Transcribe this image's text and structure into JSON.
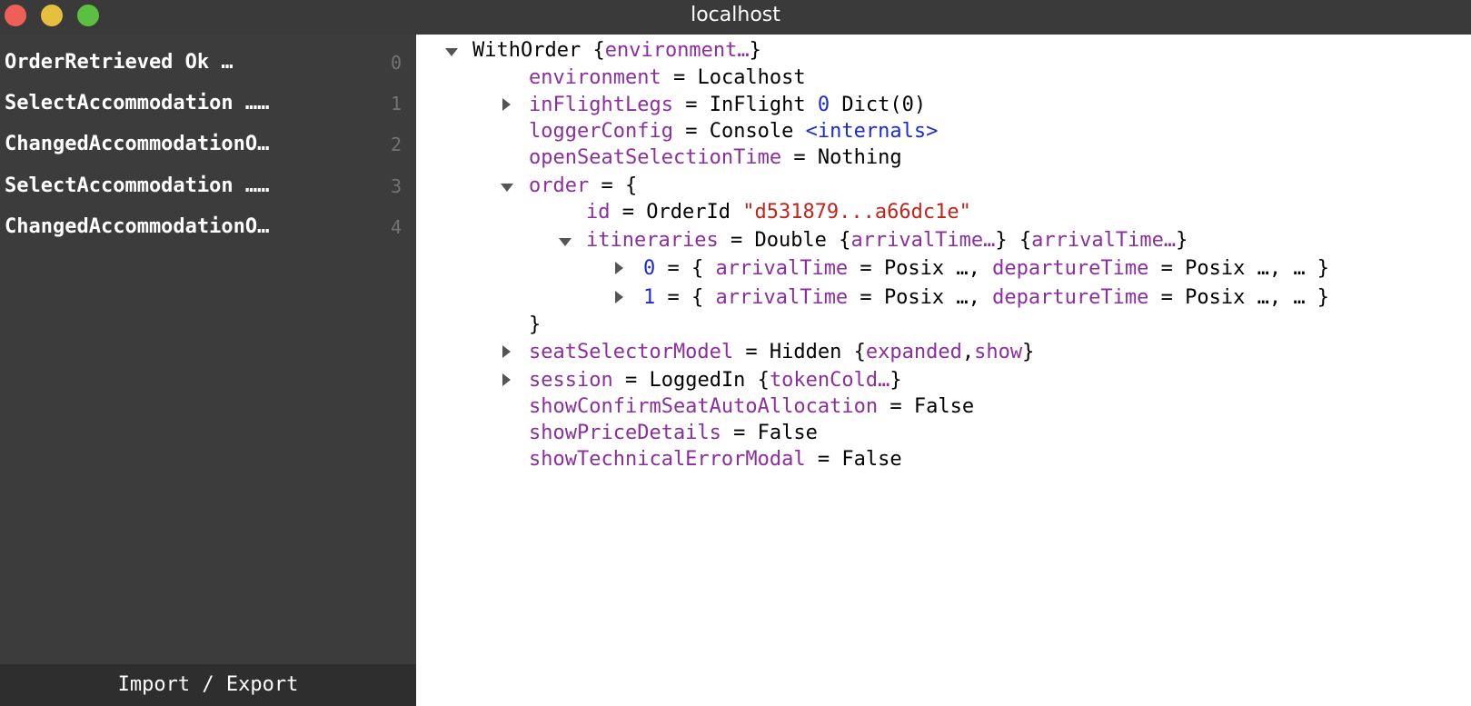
{
  "window": {
    "title": "localhost"
  },
  "sidebar": {
    "messages": [
      {
        "label": "OrderRetrieved Ok …",
        "index": "0"
      },
      {
        "label": "SelectAccommodation ……",
        "index": "1"
      },
      {
        "label": "ChangedAccommodationO…",
        "index": "2"
      },
      {
        "label": "SelectAccommodation ……",
        "index": "3"
      },
      {
        "label": "ChangedAccommodationO…",
        "index": "4"
      }
    ],
    "import_export_label": "Import / Export"
  },
  "tree": {
    "root": {
      "name": "WithOrder",
      "open_brace": "{",
      "preview": "environment…",
      "close_brace": "}"
    },
    "environment": {
      "key": "environment",
      "value": "Localhost"
    },
    "inFlightLegs": {
      "key": "inFlightLegs",
      "value": "InFlight",
      "number": "0",
      "suffix": "Dict(0)"
    },
    "loggerConfig": {
      "key": "loggerConfig",
      "value": "Console",
      "internals": "<internals>"
    },
    "openSeatSelectionTime": {
      "key": "openSeatSelectionTime",
      "value": "Nothing"
    },
    "order": {
      "key": "order",
      "open": "{",
      "close": "}",
      "id": {
        "key": "id",
        "value": "OrderId",
        "string": "\"d531879...a66dc1e\""
      },
      "itineraries": {
        "key": "itineraries",
        "value": "Double",
        "preview": "arrivalTime…",
        "items": [
          {
            "index": "0",
            "k1": "arrivalTime",
            "v1": "Posix …",
            "k2": "departureTime",
            "v2": "Posix …",
            "tail": "… }"
          },
          {
            "index": "1",
            "k1": "arrivalTime",
            "v1": "Posix …",
            "k2": "departureTime",
            "v2": "Posix …",
            "tail": "… }"
          }
        ]
      }
    },
    "seatSelectorModel": {
      "key": "seatSelectorModel",
      "value": "Hidden",
      "f1": "expanded",
      "f2": "show"
    },
    "session": {
      "key": "session",
      "value": "LoggedIn",
      "preview": "tokenCold…"
    },
    "showConfirmSeatAutoAllocation": {
      "key": "showConfirmSeatAutoAllocation",
      "value": "False"
    },
    "showPriceDetails": {
      "key": "showPriceDetails",
      "value": "False"
    },
    "showTechnicalErrorModal": {
      "key": "showTechnicalErrorModal",
      "value": "False"
    }
  }
}
